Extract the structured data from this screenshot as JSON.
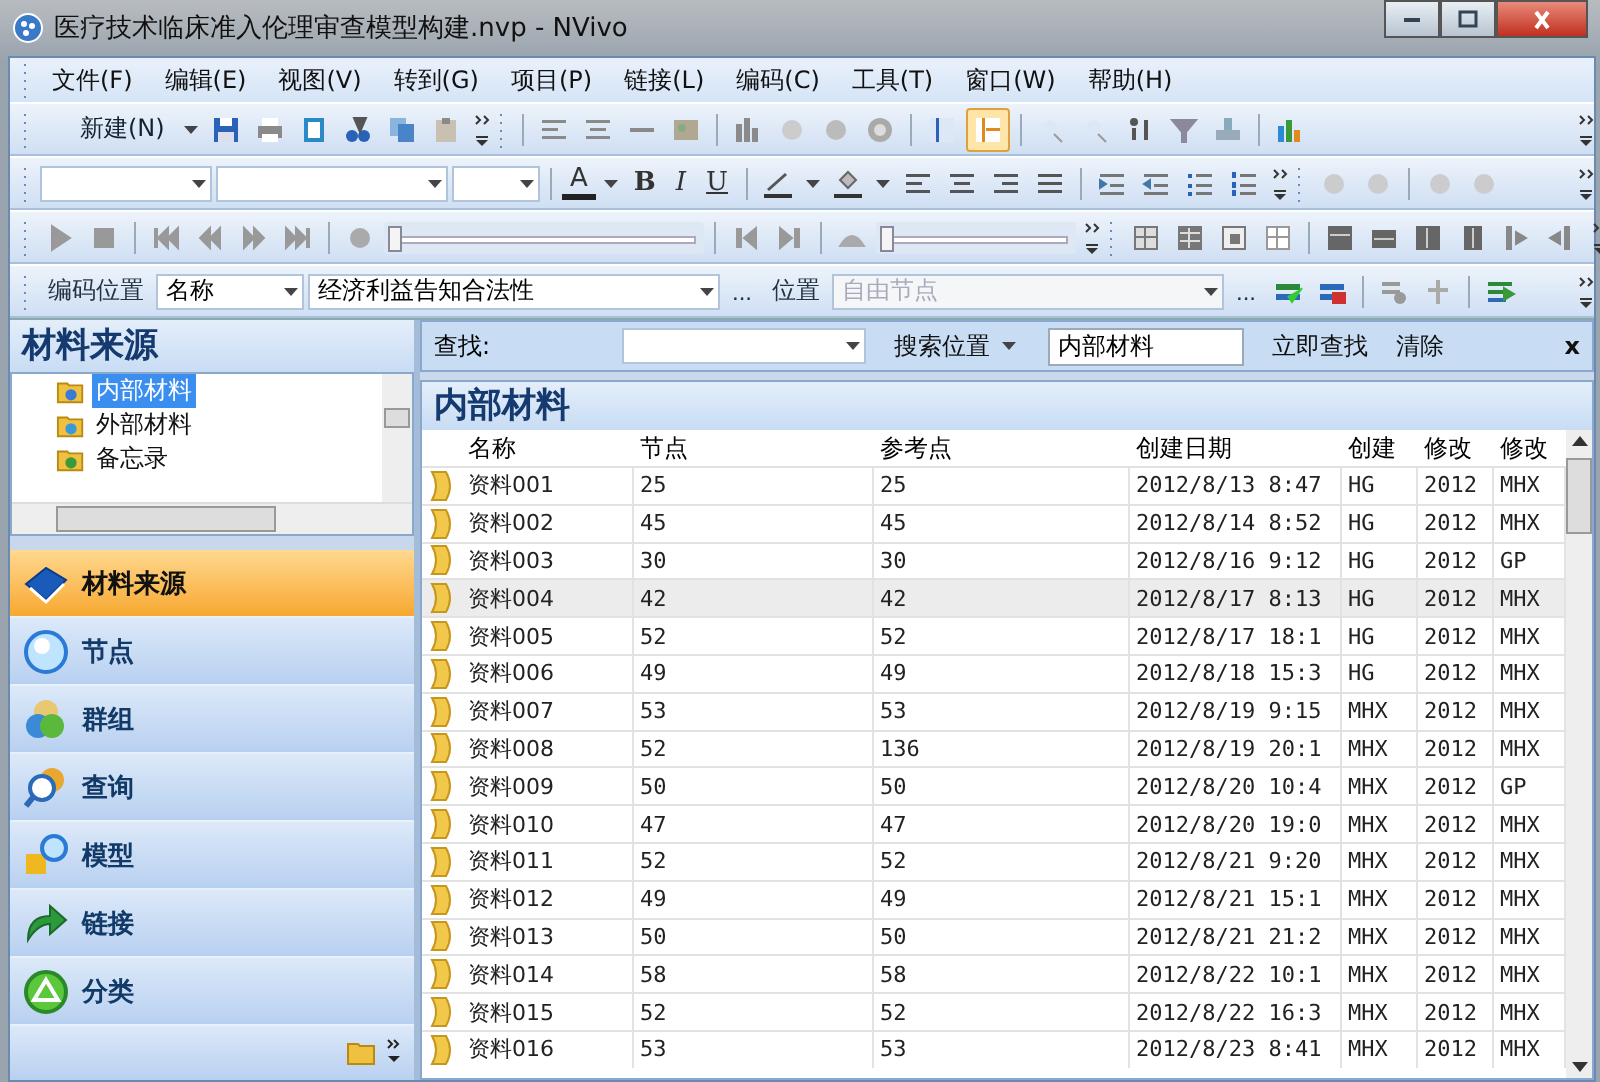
{
  "window": {
    "title": "医疗技术临床准入伦理审查模型构建.nvp - NVivo"
  },
  "menu": [
    "文件(F)",
    "编辑(E)",
    "视图(V)",
    "转到(G)",
    "项目(P)",
    "链接(L)",
    "编码(C)",
    "工具(T)",
    "窗口(W)",
    "帮助(H)"
  ],
  "toolbar": {
    "new_button": "新建(N)",
    "font_color": "A",
    "bold": "B",
    "italic": "I",
    "underline": "U",
    "code_at_label": "编码位置",
    "code_at_kind": "名称",
    "code_at_node": "经济利益告知合法性",
    "browse_node": "...",
    "location_label": "位置",
    "location_value": "自由节点",
    "location_disabled": true,
    "browse_location": "...",
    "media_sliders": [
      {
        "level": 0
      },
      {
        "level": 0
      }
    ]
  },
  "navigator": {
    "title": "材料来源",
    "tree": [
      {
        "label": "内部材料",
        "selected": true
      },
      {
        "label": "外部材料",
        "selected": false
      },
      {
        "label": "备忘录",
        "selected": false
      }
    ],
    "buttons": [
      {
        "label": "材料来源",
        "kind": "sources",
        "selected": true
      },
      {
        "label": "节点",
        "kind": "nodes",
        "selected": false
      },
      {
        "label": "群组",
        "kind": "sets",
        "selected": false
      },
      {
        "label": "查询",
        "kind": "queries",
        "selected": false
      },
      {
        "label": "模型",
        "kind": "models",
        "selected": false
      },
      {
        "label": "链接",
        "kind": "links",
        "selected": false
      },
      {
        "label": "分类",
        "kind": "classifications",
        "selected": false
      }
    ]
  },
  "find_bar": {
    "label": "查找:",
    "search_in": "搜索位置",
    "scope": "内部材料",
    "find_now": "立即查找",
    "clear": "清除",
    "close": "x"
  },
  "list": {
    "title": "内部材料",
    "columns": [
      "名称",
      "节点",
      "参考点",
      "创建日期",
      "创建",
      "修改",
      "修改"
    ],
    "rows": [
      {
        "cells": [
          "资料001",
          "25",
          "25",
          "2012/8/13 8:47",
          "HG",
          "2012",
          "MHX"
        ],
        "selected": false
      },
      {
        "cells": [
          "资料002",
          "45",
          "45",
          "2012/8/14 8:52",
          "HG",
          "2012",
          "MHX"
        ],
        "selected": false
      },
      {
        "cells": [
          "资料003",
          "30",
          "30",
          "2012/8/16 9:12",
          "HG",
          "2012",
          "GP"
        ],
        "selected": false
      },
      {
        "cells": [
          "资料004",
          "42",
          "42",
          "2012/8/17 8:13",
          "HG",
          "2012",
          "MHX"
        ],
        "selected": true
      },
      {
        "cells": [
          "资料005",
          "52",
          "52",
          "2012/8/17 18:1",
          "HG",
          "2012",
          "MHX"
        ],
        "selected": false
      },
      {
        "cells": [
          "资料006",
          "49",
          "49",
          "2012/8/18 15:3",
          "HG",
          "2012",
          "MHX"
        ],
        "selected": false
      },
      {
        "cells": [
          "资料007",
          "53",
          "53",
          "2012/8/19 9:15",
          "MHX",
          "2012",
          "MHX"
        ],
        "selected": false
      },
      {
        "cells": [
          "资料008",
          "52",
          "136",
          "2012/8/19 20:1",
          "MHX",
          "2012",
          "MHX"
        ],
        "selected": false
      },
      {
        "cells": [
          "资料009",
          "50",
          "50",
          "2012/8/20 10:4",
          "MHX",
          "2012",
          "GP"
        ],
        "selected": false
      },
      {
        "cells": [
          "资料010",
          "47",
          "47",
          "2012/8/20 19:0",
          "MHX",
          "2012",
          "MHX"
        ],
        "selected": false
      },
      {
        "cells": [
          "资料011",
          "52",
          "52",
          "2012/8/21 9:20",
          "MHX",
          "2012",
          "MHX"
        ],
        "selected": false
      },
      {
        "cells": [
          "资料012",
          "49",
          "49",
          "2012/8/21 15:1",
          "MHX",
          "2012",
          "MHX"
        ],
        "selected": false
      },
      {
        "cells": [
          "资料013",
          "50",
          "50",
          "2012/8/21 21:2",
          "MHX",
          "2012",
          "MHX"
        ],
        "selected": false
      },
      {
        "cells": [
          "资料014",
          "58",
          "58",
          "2012/8/22 10:1",
          "MHX",
          "2012",
          "MHX"
        ],
        "selected": false
      },
      {
        "cells": [
          "资料015",
          "52",
          "52",
          "2012/8/22 16:3",
          "MHX",
          "2012",
          "MHX"
        ],
        "selected": false
      },
      {
        "cells": [
          "资料016",
          "53",
          "53",
          "2012/8/23 8:41",
          "MHX",
          "2012",
          "MHX"
        ],
        "selected": false
      }
    ]
  }
}
